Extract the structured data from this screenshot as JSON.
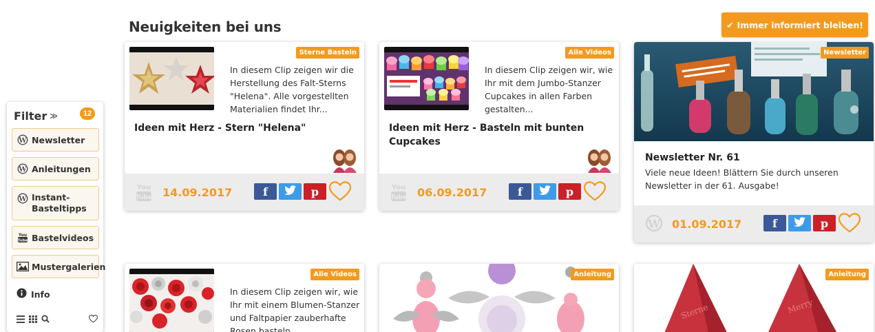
{
  "header": {
    "title": "Neuigkeiten bei uns",
    "cta_label": "Immer informiert bleiben!"
  },
  "filter": {
    "title": "Filter",
    "count": "12",
    "items": [
      {
        "label": "Newsletter",
        "icon": "wordpress-icon"
      },
      {
        "label": "Anleitungen",
        "icon": "wordpress-icon"
      },
      {
        "label": "Instant-Basteltipps",
        "icon": "wordpress-icon"
      },
      {
        "label": "Bastelvideos",
        "icon": "youtube-icon"
      },
      {
        "label": "Mustergalerien",
        "icon": "image-icon"
      }
    ],
    "info_label": "Info"
  },
  "cards": [
    {
      "tag": "Sterne Basteln",
      "description": "In diesem Clip zeigen wir die Herstellung des Falt-Sterns \"Helena\". Alle vorgestellten Materialien findet Ihr...",
      "title": "Ideen mit Herz - Stern \"Helena\"",
      "date": "14.09.2017",
      "source_icon": "youtube-icon"
    },
    {
      "tag": "Alle Videos",
      "description": "In diesem Clip zeigen wir, wie Ihr mit dem Jumbo-Stanzer Cupcakes in allen Farben gestalten...",
      "title": "Ideen mit Herz - Basteln mit bunten Cupcakes",
      "date": "06.09.2017",
      "source_icon": "youtube-icon"
    },
    {
      "tag": "Newsletter",
      "title": "Newsletter Nr. 61",
      "description": "Viele neue Ideen! Blättern Sie durch unseren Newsletter in der 61. Ausgabe!",
      "date": "01.09.2017",
      "source_icon": "wordpress-icon"
    },
    {
      "tag": "Alle Videos",
      "description": "In diesem Clip zeigen wir, wie Ihr mit einem Blumen-Stanzer und Faltpapier zauberhafte Rosen basteln..."
    },
    {
      "tag": "Anleitung"
    },
    {
      "tag": "Anleitung"
    }
  ],
  "social": {
    "facebook": "f",
    "pinterest": "p"
  },
  "colors": {
    "accent": "#f39a1e",
    "facebook": "#3b5998",
    "twitter": "#3d9be9",
    "pinterest": "#cb2027",
    "footer": "#ececec"
  }
}
